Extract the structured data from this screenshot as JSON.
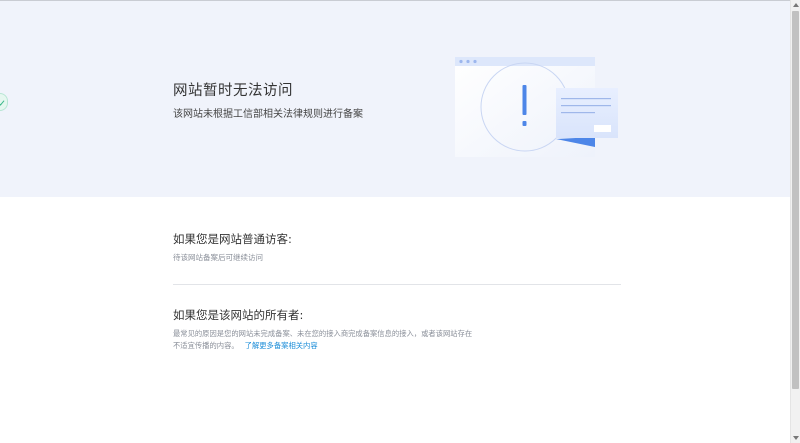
{
  "hero": {
    "title": "网站暂时无法访问",
    "subtitle": "该网站未根据工信部相关法律规则进行备案"
  },
  "visitor": {
    "heading": "如果您是网站普通访客:",
    "text": "待该网站备案后可继续访问"
  },
  "owner": {
    "heading": "如果您是该网站的所有者:",
    "line1": "最常见的原因是您的网站未完成备案、未在您的接入商完成备案信息的接入，或者该网站存在",
    "line2": "不适宜传播的内容。",
    "link": "了解更多备案相关内容"
  },
  "colors": {
    "hero_bg": "#f0f3fb",
    "accent": "#1a8cd8",
    "illustration_blue": "#4d86e8"
  },
  "icons": [
    "exclamation-icon",
    "check-icon",
    "browser-window-icon",
    "document-card-icon"
  ]
}
